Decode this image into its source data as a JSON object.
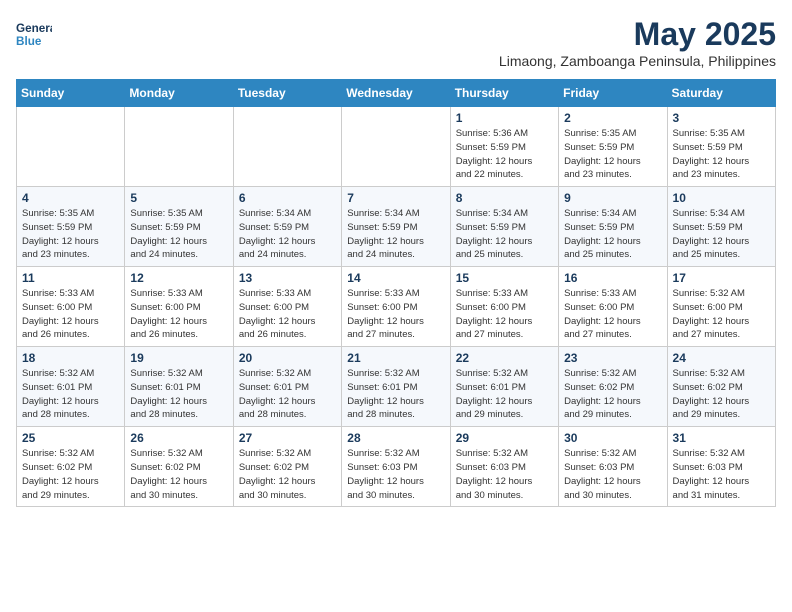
{
  "logo": {
    "line1": "General",
    "line2": "Blue"
  },
  "title": "May 2025",
  "subtitle": "Limaong, Zamboanga Peninsula, Philippines",
  "days_of_week": [
    "Sunday",
    "Monday",
    "Tuesday",
    "Wednesday",
    "Thursday",
    "Friday",
    "Saturday"
  ],
  "weeks": [
    [
      {
        "day": "",
        "info": ""
      },
      {
        "day": "",
        "info": ""
      },
      {
        "day": "",
        "info": ""
      },
      {
        "day": "",
        "info": ""
      },
      {
        "day": "1",
        "info": "Sunrise: 5:36 AM\nSunset: 5:59 PM\nDaylight: 12 hours\nand 22 minutes."
      },
      {
        "day": "2",
        "info": "Sunrise: 5:35 AM\nSunset: 5:59 PM\nDaylight: 12 hours\nand 23 minutes."
      },
      {
        "day": "3",
        "info": "Sunrise: 5:35 AM\nSunset: 5:59 PM\nDaylight: 12 hours\nand 23 minutes."
      }
    ],
    [
      {
        "day": "4",
        "info": "Sunrise: 5:35 AM\nSunset: 5:59 PM\nDaylight: 12 hours\nand 23 minutes."
      },
      {
        "day": "5",
        "info": "Sunrise: 5:35 AM\nSunset: 5:59 PM\nDaylight: 12 hours\nand 24 minutes."
      },
      {
        "day": "6",
        "info": "Sunrise: 5:34 AM\nSunset: 5:59 PM\nDaylight: 12 hours\nand 24 minutes."
      },
      {
        "day": "7",
        "info": "Sunrise: 5:34 AM\nSunset: 5:59 PM\nDaylight: 12 hours\nand 24 minutes."
      },
      {
        "day": "8",
        "info": "Sunrise: 5:34 AM\nSunset: 5:59 PM\nDaylight: 12 hours\nand 25 minutes."
      },
      {
        "day": "9",
        "info": "Sunrise: 5:34 AM\nSunset: 5:59 PM\nDaylight: 12 hours\nand 25 minutes."
      },
      {
        "day": "10",
        "info": "Sunrise: 5:34 AM\nSunset: 5:59 PM\nDaylight: 12 hours\nand 25 minutes."
      }
    ],
    [
      {
        "day": "11",
        "info": "Sunrise: 5:33 AM\nSunset: 6:00 PM\nDaylight: 12 hours\nand 26 minutes."
      },
      {
        "day": "12",
        "info": "Sunrise: 5:33 AM\nSunset: 6:00 PM\nDaylight: 12 hours\nand 26 minutes."
      },
      {
        "day": "13",
        "info": "Sunrise: 5:33 AM\nSunset: 6:00 PM\nDaylight: 12 hours\nand 26 minutes."
      },
      {
        "day": "14",
        "info": "Sunrise: 5:33 AM\nSunset: 6:00 PM\nDaylight: 12 hours\nand 27 minutes."
      },
      {
        "day": "15",
        "info": "Sunrise: 5:33 AM\nSunset: 6:00 PM\nDaylight: 12 hours\nand 27 minutes."
      },
      {
        "day": "16",
        "info": "Sunrise: 5:33 AM\nSunset: 6:00 PM\nDaylight: 12 hours\nand 27 minutes."
      },
      {
        "day": "17",
        "info": "Sunrise: 5:32 AM\nSunset: 6:00 PM\nDaylight: 12 hours\nand 27 minutes."
      }
    ],
    [
      {
        "day": "18",
        "info": "Sunrise: 5:32 AM\nSunset: 6:01 PM\nDaylight: 12 hours\nand 28 minutes."
      },
      {
        "day": "19",
        "info": "Sunrise: 5:32 AM\nSunset: 6:01 PM\nDaylight: 12 hours\nand 28 minutes."
      },
      {
        "day": "20",
        "info": "Sunrise: 5:32 AM\nSunset: 6:01 PM\nDaylight: 12 hours\nand 28 minutes."
      },
      {
        "day": "21",
        "info": "Sunrise: 5:32 AM\nSunset: 6:01 PM\nDaylight: 12 hours\nand 28 minutes."
      },
      {
        "day": "22",
        "info": "Sunrise: 5:32 AM\nSunset: 6:01 PM\nDaylight: 12 hours\nand 29 minutes."
      },
      {
        "day": "23",
        "info": "Sunrise: 5:32 AM\nSunset: 6:02 PM\nDaylight: 12 hours\nand 29 minutes."
      },
      {
        "day": "24",
        "info": "Sunrise: 5:32 AM\nSunset: 6:02 PM\nDaylight: 12 hours\nand 29 minutes."
      }
    ],
    [
      {
        "day": "25",
        "info": "Sunrise: 5:32 AM\nSunset: 6:02 PM\nDaylight: 12 hours\nand 29 minutes."
      },
      {
        "day": "26",
        "info": "Sunrise: 5:32 AM\nSunset: 6:02 PM\nDaylight: 12 hours\nand 30 minutes."
      },
      {
        "day": "27",
        "info": "Sunrise: 5:32 AM\nSunset: 6:02 PM\nDaylight: 12 hours\nand 30 minutes."
      },
      {
        "day": "28",
        "info": "Sunrise: 5:32 AM\nSunset: 6:03 PM\nDaylight: 12 hours\nand 30 minutes."
      },
      {
        "day": "29",
        "info": "Sunrise: 5:32 AM\nSunset: 6:03 PM\nDaylight: 12 hours\nand 30 minutes."
      },
      {
        "day": "30",
        "info": "Sunrise: 5:32 AM\nSunset: 6:03 PM\nDaylight: 12 hours\nand 30 minutes."
      },
      {
        "day": "31",
        "info": "Sunrise: 5:32 AM\nSunset: 6:03 PM\nDaylight: 12 hours\nand 31 minutes."
      }
    ]
  ]
}
